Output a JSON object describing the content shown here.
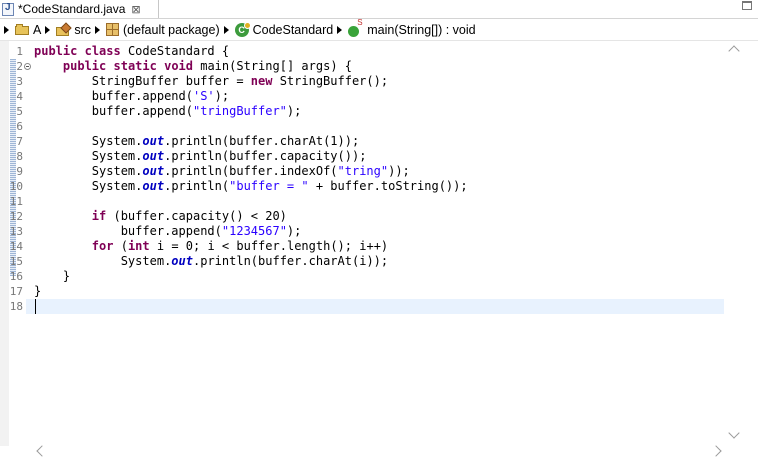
{
  "tab": {
    "title": "*CodeStandard.java",
    "close_label": "⊠",
    "icon": "java-file-icon"
  },
  "breadcrumb": [
    {
      "label": "A",
      "icon": "project-folder-icon"
    },
    {
      "label": "src",
      "icon": "source-folder-icon"
    },
    {
      "label": "(default package)",
      "icon": "package-icon"
    },
    {
      "label": "CodeStandard",
      "icon": "class-icon"
    },
    {
      "label": "main(String[]) : void",
      "icon": "method-icon"
    }
  ],
  "editor": {
    "current_line": 18,
    "line_numbers": [
      "1",
      "2",
      "3",
      "4",
      "5",
      "6",
      "7",
      "8",
      "9",
      "10",
      "11",
      "12",
      "13",
      "14",
      "15",
      "16",
      "17",
      "18"
    ],
    "lines": [
      "public class CodeStandard {",
      "    public static void main(String[] args) {",
      "        StringBuffer buffer = new StringBuffer();",
      "        buffer.append('S');",
      "        buffer.append(\"tringBuffer\");",
      "",
      "        System.out.println(buffer.charAt(1));",
      "        System.out.println(buffer.capacity());",
      "        System.out.println(buffer.indexOf(\"tring\"));",
      "        System.out.println(\"buffer = \" + buffer.toString());",
      "",
      "        if (buffer.capacity() < 20)",
      "            buffer.append(\"1234567\");",
      "        for (int i = 0; i < buffer.length(); i++)",
      "            System.out.println(buffer.charAt(i));",
      "    }",
      "}",
      ""
    ]
  },
  "colors": {
    "keyword": "#7f0055",
    "string": "#2a00ff",
    "static_field": "#0000c0",
    "current_line": "#e8f2fe"
  }
}
